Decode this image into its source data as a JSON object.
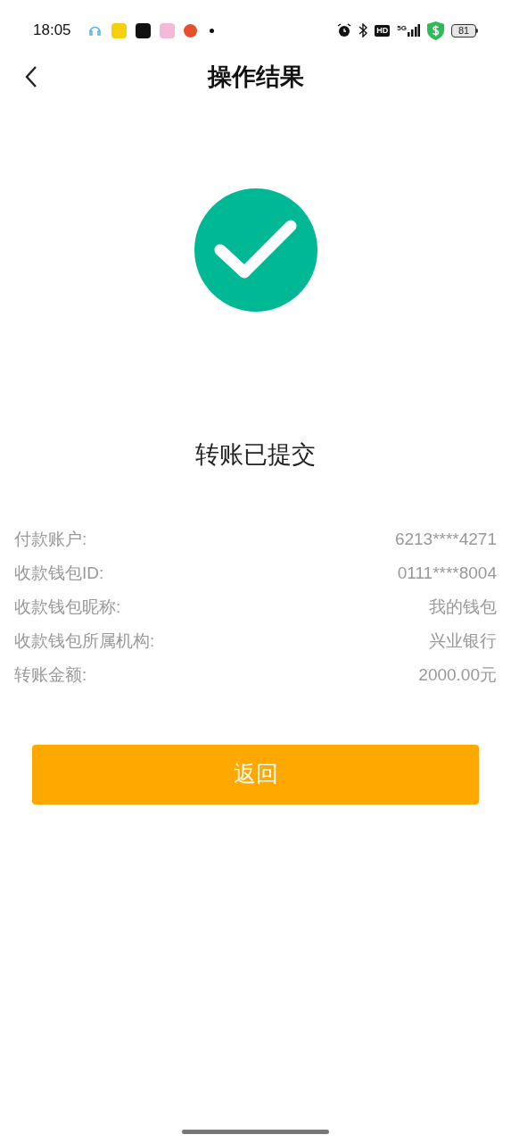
{
  "status_bar": {
    "time": "18:05",
    "hd": "HD",
    "network": "5G",
    "battery": "81"
  },
  "nav": {
    "title": "操作结果"
  },
  "result": {
    "message": "转账已提交"
  },
  "details": [
    {
      "label": "付款账户:",
      "value": "6213****4271"
    },
    {
      "label": "收款钱包ID:",
      "value": "0111****8004"
    },
    {
      "label": "收款钱包昵称:",
      "value": "我的钱包"
    },
    {
      "label": "收款钱包所属机构:",
      "value": "兴业银行"
    },
    {
      "label": "转账金额:",
      "value": "2000.00元"
    }
  ],
  "button": {
    "label": "返回"
  }
}
